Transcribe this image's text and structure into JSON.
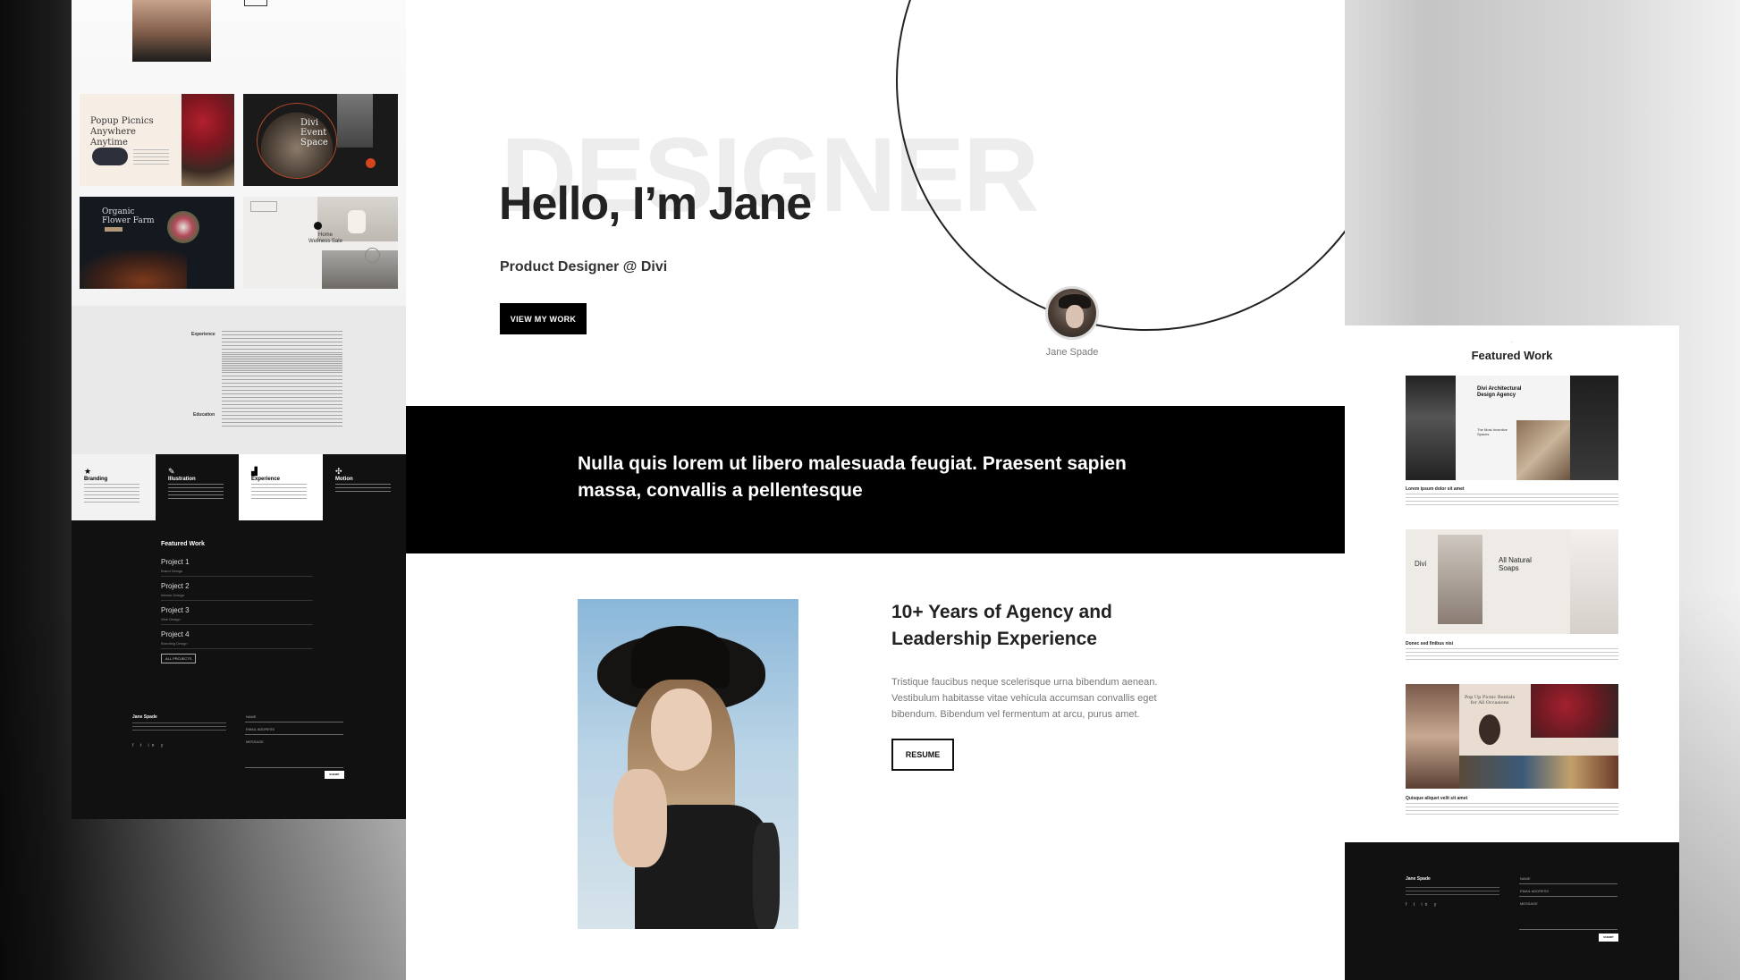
{
  "hero": {
    "bg_word": "DESIGNER",
    "heading": "Hello, I’m Jane",
    "subtitle": "Product Designer @ Divi",
    "cta_label": "VIEW MY WORK",
    "avatar_name": "Jane Spade"
  },
  "quote_band": {
    "text": "Nulla quis lorem ut libero malesuada feugiat. Praesent sapien massa, convallis a pellentesque"
  },
  "about": {
    "heading": "10+ Years of Agency and Leadership Experience",
    "paragraph": "Tristique faucibus neque scelerisque urna bibendum aenean. Vestibulum habitasse vitae vehicula accumsan convallis eget bibendum. Bibendum vel fermentum at arcu, purus amet.",
    "resume_label": "RESUME"
  },
  "left_preview": {
    "tiles": [
      {
        "title": "Popup Picnics Anywhere Anytime"
      },
      {
        "title": "Divi Event Space"
      },
      {
        "title": "Organic Flower Farm"
      },
      {
        "title": "Home Wellness Sale"
      }
    ],
    "experience_label": "Experience",
    "education_label": "Education",
    "services": [
      "Branding",
      "Illustration",
      "Experience",
      "Motion"
    ],
    "featured_title": "Featured Work",
    "projects": [
      {
        "name": "Project 1",
        "sub": "Brand Design"
      },
      {
        "name": "Project 2",
        "sub": "Interior Design"
      },
      {
        "name": "Project 3",
        "sub": "Web Design"
      },
      {
        "name": "Project 4",
        "sub": "Branding Design"
      }
    ],
    "all_projects_label": "ALL PROJECTS",
    "footer_name": "Jane Spade",
    "form_fields": [
      "NAME",
      "EMAIL ADDRESS",
      "MESSAGE"
    ],
    "submit_label": "SUBMIT"
  },
  "right_preview": {
    "title": "Featured Work",
    "items": [
      {
        "caption": "Lorem ipsum dolor sit amet",
        "tile_text": "Divi Architectural Design Agency",
        "tile_text2": "The Most Inventive Spaces"
      },
      {
        "caption": "Donec sed finibus nisi",
        "tile_text": "All Natural Soaps",
        "tile_text2": "Divi"
      },
      {
        "caption": "Quisque aliquet velit sit amet",
        "tile_text": "Pop Up Picnic Rentals for All Occasions",
        "tile_text2": ""
      }
    ],
    "footer_name": "Jane Spade",
    "form_fields": [
      "NAME",
      "EMAIL ADDRESS",
      "MESSAGE"
    ],
    "submit_label": "SUBMIT"
  },
  "colors": {
    "accent": "#000000",
    "text": "#222222",
    "muted": "#777777"
  }
}
